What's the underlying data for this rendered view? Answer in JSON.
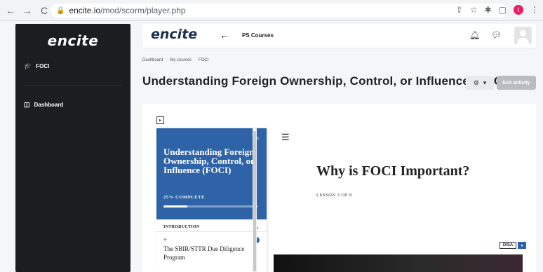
{
  "browser": {
    "url_host": "encite.io",
    "url_path": "/mod/scorm/player.php",
    "profile_initial": "I"
  },
  "sidebar": {
    "brand": "encite",
    "items": [
      {
        "label": "FOCI",
        "icon": "graduation-cap-icon"
      },
      {
        "label": "Dashboard",
        "icon": "dashboard-icon"
      }
    ]
  },
  "header": {
    "logo": "encite",
    "course_title": "PS Courses"
  },
  "breadcrumb": [
    "Dashboard",
    "My courses",
    "FOCI"
  ],
  "page_title": "Understanding Foreign Ownership, Control, or Influence (FOCI)",
  "actions": {
    "exit_label": "Exit activity"
  },
  "lesson_panel": {
    "title": "Understanding Foreign Ownership, Control, or Influence (FOCI)",
    "progress_label": "25% COMPLETE",
    "progress_fraction": 0.25,
    "section_label": "INTRODUCTION",
    "lessons": [
      {
        "name": "The SBIR/STTR Due Diligence Program",
        "completed": true
      }
    ]
  },
  "lesson": {
    "title": "Why is FOCI Important?",
    "number_label": "LESSON 3 OF 8"
  },
  "badge": {
    "label": "DISA"
  },
  "colors": {
    "sidebar_bg": "#1b1d21",
    "brand_navy": "#1a3050",
    "lesson_blue": "#2e63a8",
    "exit_button": "#b9bcc1"
  }
}
